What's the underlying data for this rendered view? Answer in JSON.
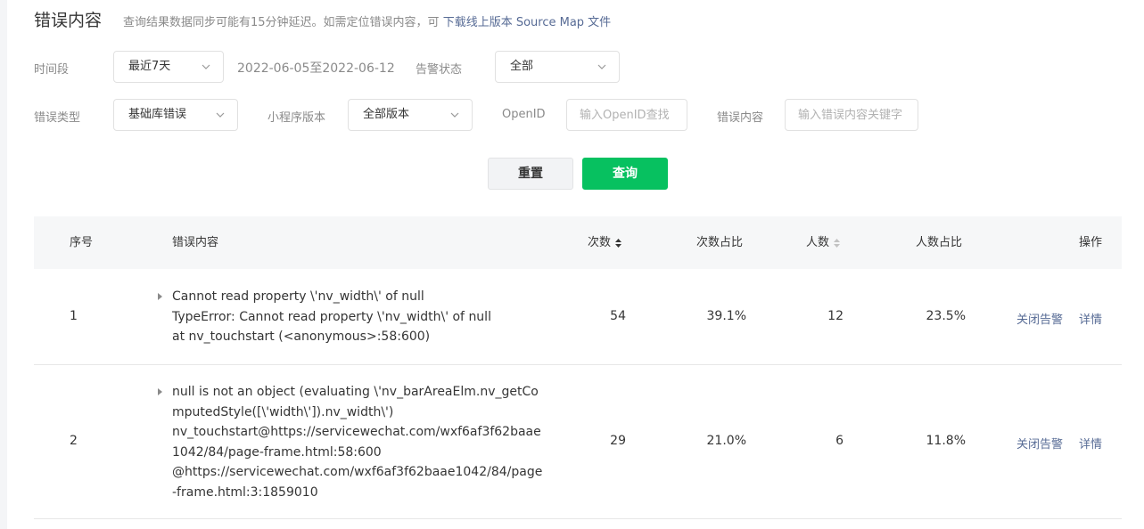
{
  "header": {
    "title": "错误内容",
    "note": "查询结果数据同步可能有15分钟延迟。如需定位错误内容，可",
    "note_link": "下载线上版本 Source Map 文件"
  },
  "filters": {
    "period_label": "时间段",
    "period_value": "最近7天",
    "date_range": "2022-06-05至2022-06-12",
    "alert_status_label": "告警状态",
    "alert_status_value": "全部",
    "error_type_label": "错误类型",
    "error_type_value": "基础库错误",
    "version_label": "小程序版本",
    "version_value": "全部版本",
    "openid_label": "OpenID",
    "openid_placeholder": "输入OpenID查找",
    "content_label": "错误内容",
    "content_placeholder": "输入错误内容关键字"
  },
  "buttons": {
    "reset": "重置",
    "query": "查询"
  },
  "table": {
    "headers": {
      "index": "序号",
      "content": "错误内容",
      "count": "次数",
      "count_ratio": "次数占比",
      "users": "人数",
      "user_ratio": "人数占比",
      "ops": "操作"
    },
    "rows": [
      {
        "index": "1",
        "content": "Cannot read property \\'nv_width\\' of null\nTypeError: Cannot read property \\'nv_width\\' of null\nat nv_touchstart (<anonymous>:58:600)",
        "count": "54",
        "count_ratio": "39.1%",
        "users": "12",
        "user_ratio": "23.5%",
        "close_alert": "关闭告警",
        "detail": "详情"
      },
      {
        "index": "2",
        "content": "null is not an object (evaluating \\'nv_barAreaElm.nv_getCo\nmputedStyle([\\'width\\']).nv_width\\')\nnv_touchstart@https://servicewechat.com/wxf6af3f62baae\n1042/84/page-frame.html:58:600\n@https://servicewechat.com/wxf6af3f62baae1042/84/page\n-frame.html:3:1859010",
        "count": "29",
        "count_ratio": "21.0%",
        "users": "6",
        "user_ratio": "11.8%",
        "close_alert": "关闭告警",
        "detail": "详情"
      }
    ]
  },
  "colors": {
    "accent_green": "#07c160",
    "link_blue": "#576b95"
  }
}
